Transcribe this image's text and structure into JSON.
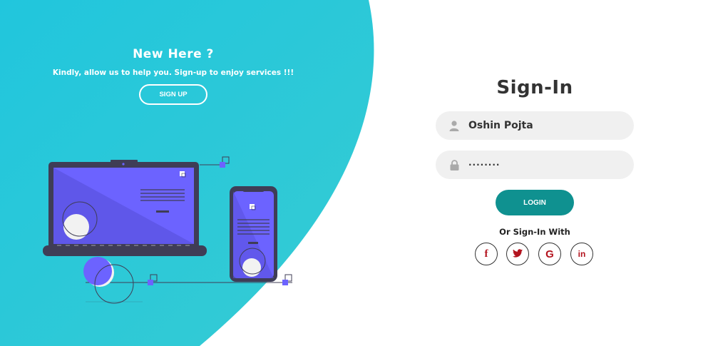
{
  "colors": {
    "teal_gradient_start": "#2ac6dc",
    "teal_gradient_end": "#2fcad6",
    "purple": "#6c63ff",
    "dark_device": "#3f3d56",
    "login_button": "#0f9190",
    "social_icon": "#b3131e",
    "field_bg": "#f0f0f0"
  },
  "left": {
    "title": "New Here ?",
    "subtitle": "Kindly, allow us to help you. Sign-up to enjoy services !!!",
    "signup_label": "SIGN UP"
  },
  "form": {
    "title": "Sign-In",
    "username_value": "Oshin Pojta",
    "password_value": "········",
    "login_label": "LOGIN",
    "or_text": "Or Sign-In With",
    "username_icon": "user-icon",
    "password_icon": "lock-icon"
  },
  "socials": [
    {
      "name": "facebook-icon",
      "glyph": "f"
    },
    {
      "name": "twitter-icon",
      "glyph": "🐦"
    },
    {
      "name": "google-icon",
      "glyph": "G"
    },
    {
      "name": "linkedin-icon",
      "glyph": "in"
    }
  ]
}
